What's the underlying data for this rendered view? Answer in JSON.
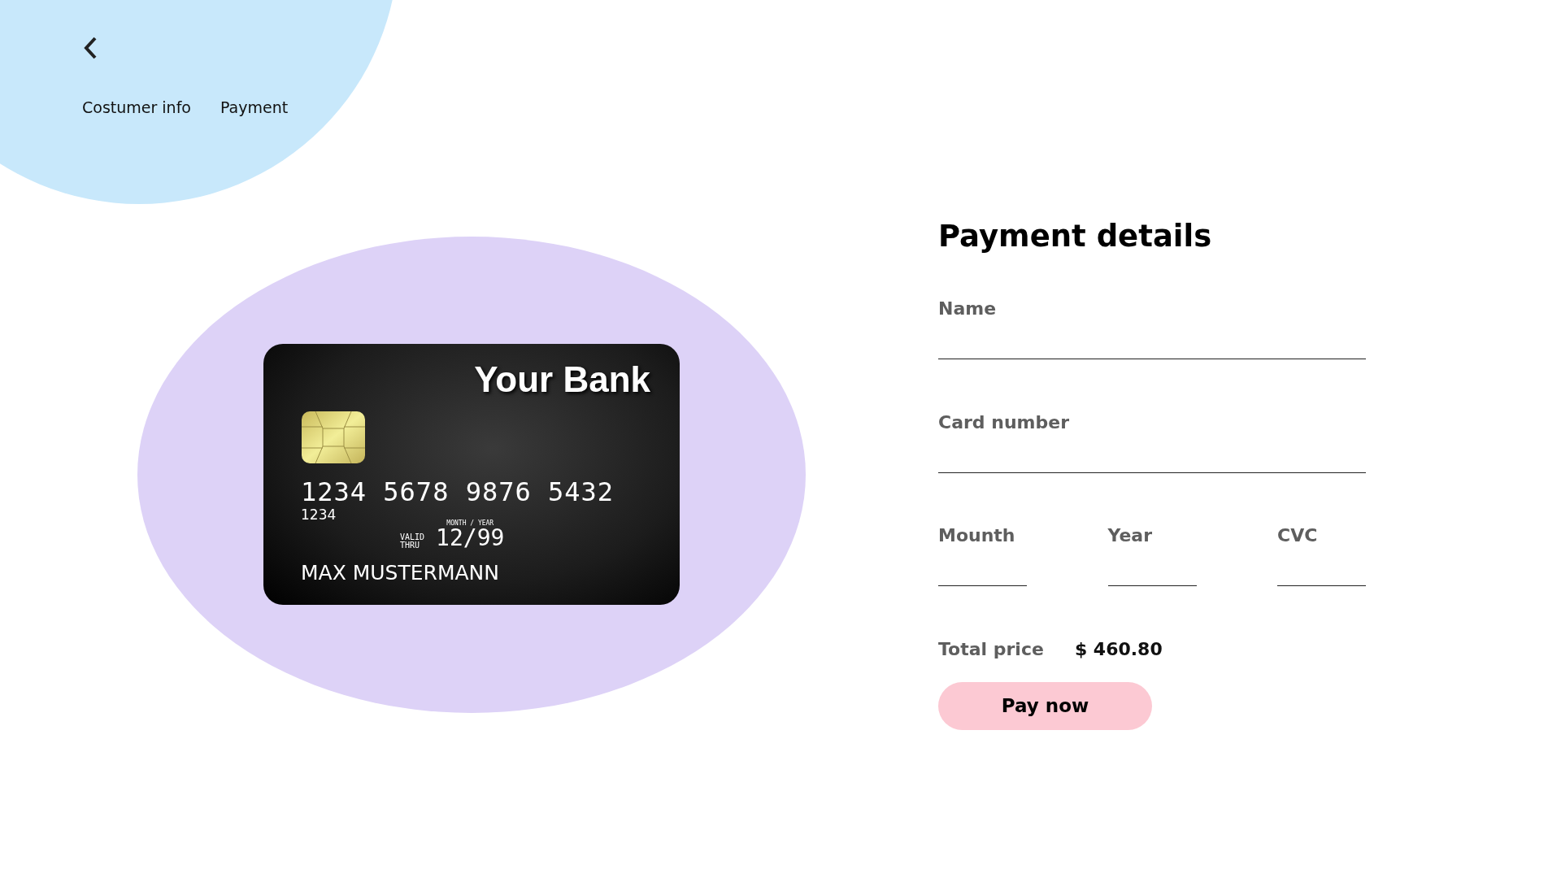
{
  "nav": {
    "tabs": [
      {
        "label": "Costumer info"
      },
      {
        "label": "Payment"
      }
    ]
  },
  "card": {
    "bank": "Your Bank",
    "number": "1234 5678 9876 5432",
    "number_small": "1234",
    "date_caption": "MONTH / YEAR",
    "valid_label": [
      "VALID",
      "THRU"
    ],
    "expiry": "12/99",
    "holder": "MAX MUSTERMANN"
  },
  "form": {
    "title": "Payment details",
    "fields": [
      {
        "label": "Name"
      },
      {
        "label": "Card number"
      }
    ],
    "split_fields": [
      {
        "label": "Mounth"
      },
      {
        "label": "Year"
      },
      {
        "label": "CVC"
      }
    ],
    "total_label": "Total price",
    "total_value": "$ 460.80",
    "button": "Pay now"
  }
}
